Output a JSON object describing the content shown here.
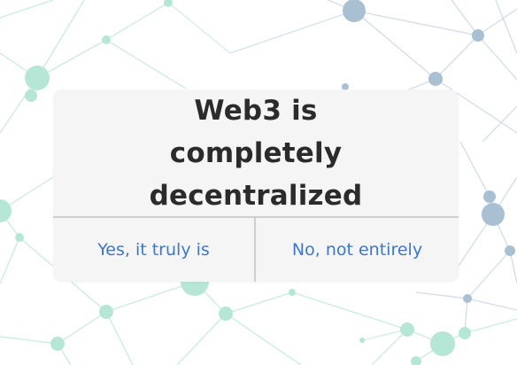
{
  "dialog": {
    "title": "Web3 is completely decentralized",
    "yes_label": "Yes, it truly is",
    "no_label": "No, not entirely"
  },
  "colors": {
    "background": "#ffffff",
    "dialog_bg": "#f5f5f5",
    "title_text": "#2b2b2b",
    "button_text": "#3b79c7",
    "divider": "#cfcfcf",
    "network_green": "#a8e0cf",
    "network_blue": "#9fb6cc"
  },
  "icons": {
    "background": "network-graph-illustration"
  }
}
